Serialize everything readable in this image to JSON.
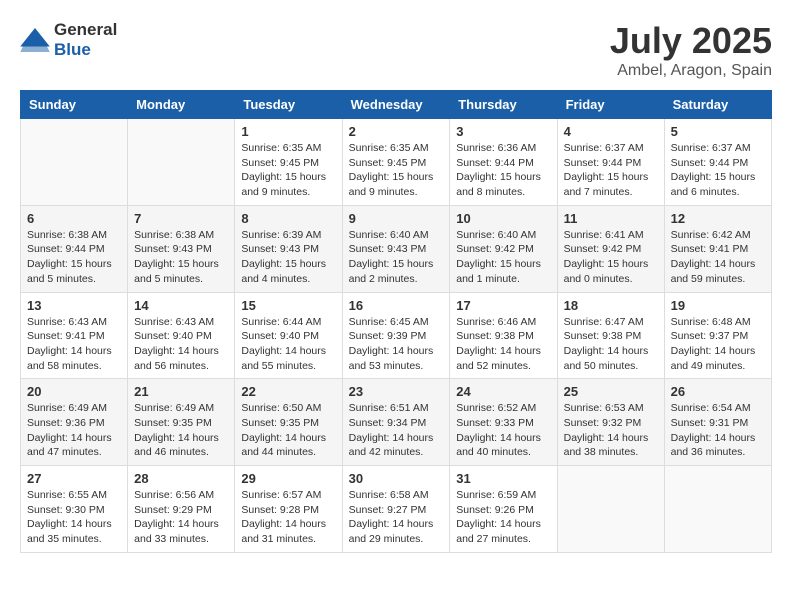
{
  "header": {
    "logo_general": "General",
    "logo_blue": "Blue",
    "month_year": "July 2025",
    "location": "Ambel, Aragon, Spain"
  },
  "weekdays": [
    "Sunday",
    "Monday",
    "Tuesday",
    "Wednesday",
    "Thursday",
    "Friday",
    "Saturday"
  ],
  "weeks": [
    [
      {
        "day": "",
        "sunrise": "",
        "sunset": "",
        "daylight": ""
      },
      {
        "day": "",
        "sunrise": "",
        "sunset": "",
        "daylight": ""
      },
      {
        "day": "1",
        "sunrise": "Sunrise: 6:35 AM",
        "sunset": "Sunset: 9:45 PM",
        "daylight": "Daylight: 15 hours and 9 minutes."
      },
      {
        "day": "2",
        "sunrise": "Sunrise: 6:35 AM",
        "sunset": "Sunset: 9:45 PM",
        "daylight": "Daylight: 15 hours and 9 minutes."
      },
      {
        "day": "3",
        "sunrise": "Sunrise: 6:36 AM",
        "sunset": "Sunset: 9:44 PM",
        "daylight": "Daylight: 15 hours and 8 minutes."
      },
      {
        "day": "4",
        "sunrise": "Sunrise: 6:37 AM",
        "sunset": "Sunset: 9:44 PM",
        "daylight": "Daylight: 15 hours and 7 minutes."
      },
      {
        "day": "5",
        "sunrise": "Sunrise: 6:37 AM",
        "sunset": "Sunset: 9:44 PM",
        "daylight": "Daylight: 15 hours and 6 minutes."
      }
    ],
    [
      {
        "day": "6",
        "sunrise": "Sunrise: 6:38 AM",
        "sunset": "Sunset: 9:44 PM",
        "daylight": "Daylight: 15 hours and 5 minutes."
      },
      {
        "day": "7",
        "sunrise": "Sunrise: 6:38 AM",
        "sunset": "Sunset: 9:43 PM",
        "daylight": "Daylight: 15 hours and 5 minutes."
      },
      {
        "day": "8",
        "sunrise": "Sunrise: 6:39 AM",
        "sunset": "Sunset: 9:43 PM",
        "daylight": "Daylight: 15 hours and 4 minutes."
      },
      {
        "day": "9",
        "sunrise": "Sunrise: 6:40 AM",
        "sunset": "Sunset: 9:43 PM",
        "daylight": "Daylight: 15 hours and 2 minutes."
      },
      {
        "day": "10",
        "sunrise": "Sunrise: 6:40 AM",
        "sunset": "Sunset: 9:42 PM",
        "daylight": "Daylight: 15 hours and 1 minute."
      },
      {
        "day": "11",
        "sunrise": "Sunrise: 6:41 AM",
        "sunset": "Sunset: 9:42 PM",
        "daylight": "Daylight: 15 hours and 0 minutes."
      },
      {
        "day": "12",
        "sunrise": "Sunrise: 6:42 AM",
        "sunset": "Sunset: 9:41 PM",
        "daylight": "Daylight: 14 hours and 59 minutes."
      }
    ],
    [
      {
        "day": "13",
        "sunrise": "Sunrise: 6:43 AM",
        "sunset": "Sunset: 9:41 PM",
        "daylight": "Daylight: 14 hours and 58 minutes."
      },
      {
        "day": "14",
        "sunrise": "Sunrise: 6:43 AM",
        "sunset": "Sunset: 9:40 PM",
        "daylight": "Daylight: 14 hours and 56 minutes."
      },
      {
        "day": "15",
        "sunrise": "Sunrise: 6:44 AM",
        "sunset": "Sunset: 9:40 PM",
        "daylight": "Daylight: 14 hours and 55 minutes."
      },
      {
        "day": "16",
        "sunrise": "Sunrise: 6:45 AM",
        "sunset": "Sunset: 9:39 PM",
        "daylight": "Daylight: 14 hours and 53 minutes."
      },
      {
        "day": "17",
        "sunrise": "Sunrise: 6:46 AM",
        "sunset": "Sunset: 9:38 PM",
        "daylight": "Daylight: 14 hours and 52 minutes."
      },
      {
        "day": "18",
        "sunrise": "Sunrise: 6:47 AM",
        "sunset": "Sunset: 9:38 PM",
        "daylight": "Daylight: 14 hours and 50 minutes."
      },
      {
        "day": "19",
        "sunrise": "Sunrise: 6:48 AM",
        "sunset": "Sunset: 9:37 PM",
        "daylight": "Daylight: 14 hours and 49 minutes."
      }
    ],
    [
      {
        "day": "20",
        "sunrise": "Sunrise: 6:49 AM",
        "sunset": "Sunset: 9:36 PM",
        "daylight": "Daylight: 14 hours and 47 minutes."
      },
      {
        "day": "21",
        "sunrise": "Sunrise: 6:49 AM",
        "sunset": "Sunset: 9:35 PM",
        "daylight": "Daylight: 14 hours and 46 minutes."
      },
      {
        "day": "22",
        "sunrise": "Sunrise: 6:50 AM",
        "sunset": "Sunset: 9:35 PM",
        "daylight": "Daylight: 14 hours and 44 minutes."
      },
      {
        "day": "23",
        "sunrise": "Sunrise: 6:51 AM",
        "sunset": "Sunset: 9:34 PM",
        "daylight": "Daylight: 14 hours and 42 minutes."
      },
      {
        "day": "24",
        "sunrise": "Sunrise: 6:52 AM",
        "sunset": "Sunset: 9:33 PM",
        "daylight": "Daylight: 14 hours and 40 minutes."
      },
      {
        "day": "25",
        "sunrise": "Sunrise: 6:53 AM",
        "sunset": "Sunset: 9:32 PM",
        "daylight": "Daylight: 14 hours and 38 minutes."
      },
      {
        "day": "26",
        "sunrise": "Sunrise: 6:54 AM",
        "sunset": "Sunset: 9:31 PM",
        "daylight": "Daylight: 14 hours and 36 minutes."
      }
    ],
    [
      {
        "day": "27",
        "sunrise": "Sunrise: 6:55 AM",
        "sunset": "Sunset: 9:30 PM",
        "daylight": "Daylight: 14 hours and 35 minutes."
      },
      {
        "day": "28",
        "sunrise": "Sunrise: 6:56 AM",
        "sunset": "Sunset: 9:29 PM",
        "daylight": "Daylight: 14 hours and 33 minutes."
      },
      {
        "day": "29",
        "sunrise": "Sunrise: 6:57 AM",
        "sunset": "Sunset: 9:28 PM",
        "daylight": "Daylight: 14 hours and 31 minutes."
      },
      {
        "day": "30",
        "sunrise": "Sunrise: 6:58 AM",
        "sunset": "Sunset: 9:27 PM",
        "daylight": "Daylight: 14 hours and 29 minutes."
      },
      {
        "day": "31",
        "sunrise": "Sunrise: 6:59 AM",
        "sunset": "Sunset: 9:26 PM",
        "daylight": "Daylight: 14 hours and 27 minutes."
      },
      {
        "day": "",
        "sunrise": "",
        "sunset": "",
        "daylight": ""
      },
      {
        "day": "",
        "sunrise": "",
        "sunset": "",
        "daylight": ""
      }
    ]
  ]
}
